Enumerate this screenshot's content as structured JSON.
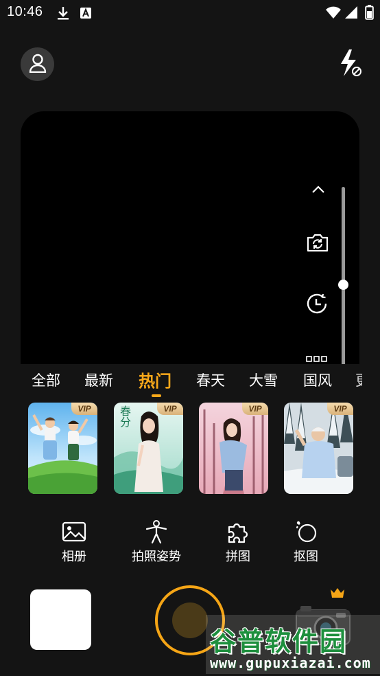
{
  "status_bar": {
    "time": "10:46",
    "left_icons": [
      "download-icon",
      "font-a-icon"
    ],
    "right_icons": [
      "wifi-icon",
      "signal-icon",
      "battery-icon"
    ]
  },
  "top_controls": {
    "profile_icon": "person-icon",
    "flash_icon": "flash-off-icon"
  },
  "viewfinder": {
    "controls": [
      "collapse-up-icon",
      "switch-camera-icon",
      "timer-icon",
      "more-grid-icon"
    ]
  },
  "tabs": [
    {
      "label": "全部",
      "active": false
    },
    {
      "label": "最新",
      "active": false
    },
    {
      "label": "热门",
      "active": true
    },
    {
      "label": "春天",
      "active": false
    },
    {
      "label": "大雪",
      "active": false
    },
    {
      "label": "国风",
      "active": false
    }
  ],
  "templates": [
    {
      "badge": "VIP",
      "scene": "kids-on-grass"
    },
    {
      "badge": "VIP",
      "scene": "spring-girl",
      "caption": "春分"
    },
    {
      "badge": "VIP",
      "scene": "pink-trees"
    },
    {
      "badge": "VIP",
      "scene": "snow-forest"
    }
  ],
  "tools": [
    {
      "label": "相册",
      "icon": "image-icon"
    },
    {
      "label": "拍照姿势",
      "icon": "pose-icon"
    },
    {
      "label": "拼图",
      "icon": "puzzle-icon"
    },
    {
      "label": "抠图",
      "icon": "cutout-icon"
    }
  ],
  "bottom": {
    "crown_icon": "crown-icon",
    "accent_color": "#f5a516"
  },
  "watermark": {
    "title": "谷普软件园",
    "url": "www.gupuxiazai.com"
  }
}
